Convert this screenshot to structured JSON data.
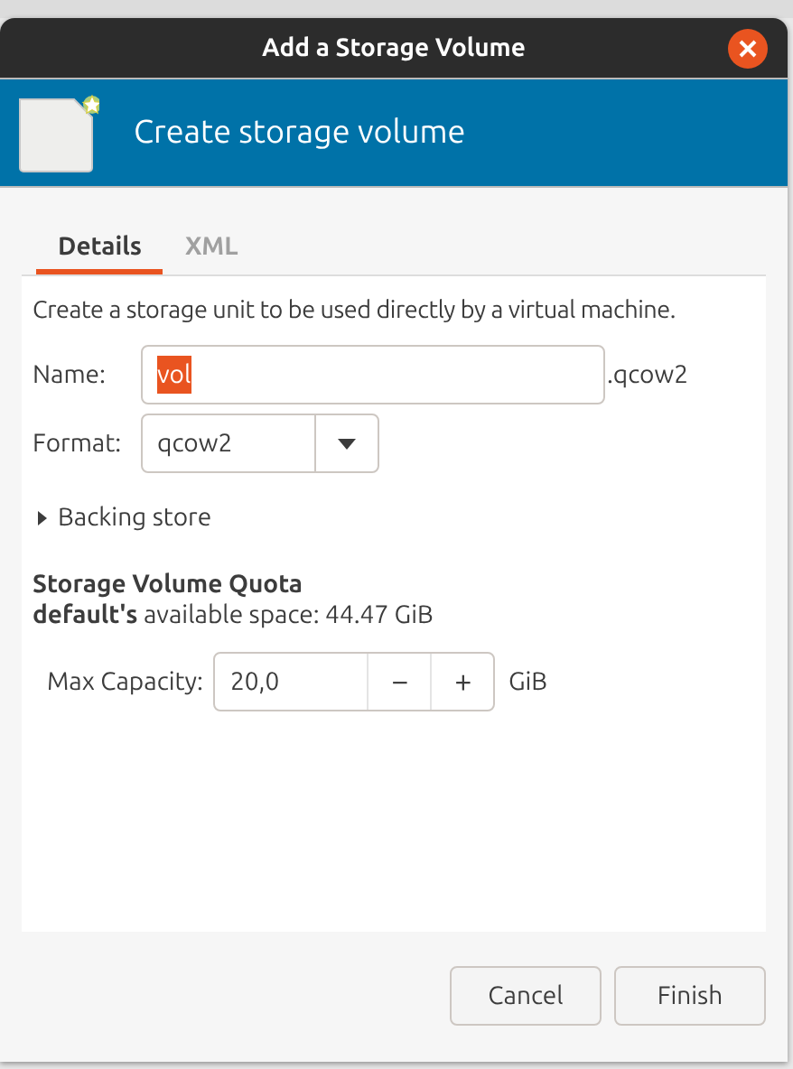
{
  "window": {
    "title": "Add a Storage Volume"
  },
  "header": {
    "title": "Create storage volume"
  },
  "tabs": [
    {
      "label": "Details",
      "selected": true
    },
    {
      "label": "XML",
      "selected": false
    }
  ],
  "description": "Create a storage unit to be used directly by a virtual machine.",
  "name_field": {
    "label": "Name:",
    "value": "vol",
    "text_selected": true,
    "suffix": ".qcow2"
  },
  "format_field": {
    "label": "Format:",
    "value": "qcow2"
  },
  "backing_store": {
    "label": "Backing store",
    "expanded": false
  },
  "quota": {
    "title": "Storage Volume Quota",
    "available": "**default's** available space: 44.47 GiB"
  },
  "capacity": {
    "label": "Max Capacity:",
    "value": "20,0",
    "decrement": "−",
    "increment": "+",
    "unit": "GiB"
  },
  "buttons": [
    "Cancel",
    "Finish"
  ]
}
